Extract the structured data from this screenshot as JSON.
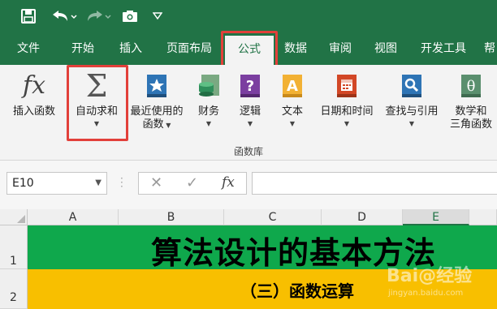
{
  "tabs": [
    {
      "label": "文件"
    },
    {
      "label": "开始"
    },
    {
      "label": "插入"
    },
    {
      "label": "页面布局"
    },
    {
      "label": "公式"
    },
    {
      "label": "数据"
    },
    {
      "label": "审阅"
    },
    {
      "label": "视图"
    },
    {
      "label": "开发工具"
    },
    {
      "label": "帮"
    }
  ],
  "active_tab": "公式",
  "ribbon": {
    "buttons": [
      {
        "line1": "插入函数",
        "line2": "",
        "icon": "fx-icon"
      },
      {
        "line1": "自动求和",
        "line2": "",
        "icon": "sigma-icon"
      },
      {
        "line1": "最近使用的",
        "line2": "函数",
        "icon": "star-book-icon"
      },
      {
        "line1": "财务",
        "line2": "",
        "icon": "coins-icon"
      },
      {
        "line1": "逻辑",
        "line2": "",
        "icon": "question-book-icon"
      },
      {
        "line1": "文本",
        "line2": "",
        "icon": "text-book-icon"
      },
      {
        "line1": "日期和时间",
        "line2": "",
        "icon": "calendar-icon"
      },
      {
        "line1": "查找与引用",
        "line2": "",
        "icon": "magnifier-book-icon"
      },
      {
        "line1": "数学和",
        "line2": "三角函数",
        "icon": "theta-book-icon"
      }
    ],
    "group_label": "函数库"
  },
  "formula_bar": {
    "name_box": "E10",
    "fx_label": "fx",
    "value": ""
  },
  "columns": [
    "A",
    "B",
    "C",
    "D",
    "E"
  ],
  "selected_column": "E",
  "rows": [
    "1",
    "2"
  ],
  "cells": {
    "row1_text": "算法设计的基本方法",
    "row2_text": "（三）函数运算"
  },
  "colors": {
    "excel_green": "#217346",
    "row1_fill": "#0fa84c",
    "row2_fill": "#f8bf00",
    "highlight": "#e2403a"
  },
  "watermark": {
    "text": "Bai@经验",
    "sub": "jingyan.baidu.com"
  }
}
